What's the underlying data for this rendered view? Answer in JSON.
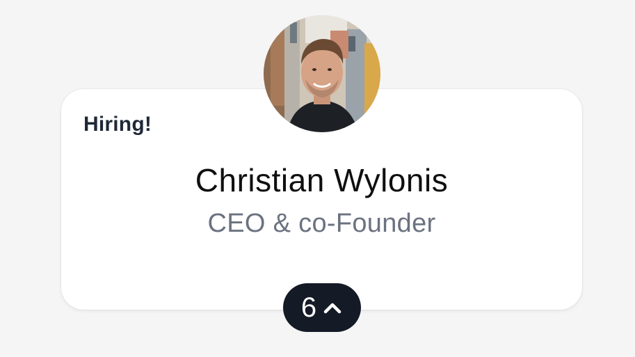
{
  "profile": {
    "badge": "Hiring!",
    "name": "Christian Wylonis",
    "role": "CEO & co-Founder"
  },
  "upvote": {
    "count": "6",
    "icon": "chevron-up-icon"
  },
  "colors": {
    "background": "#f5f5f5",
    "card": "#ffffff",
    "upvote_bg": "#141a26",
    "role_text": "#6b7280"
  }
}
